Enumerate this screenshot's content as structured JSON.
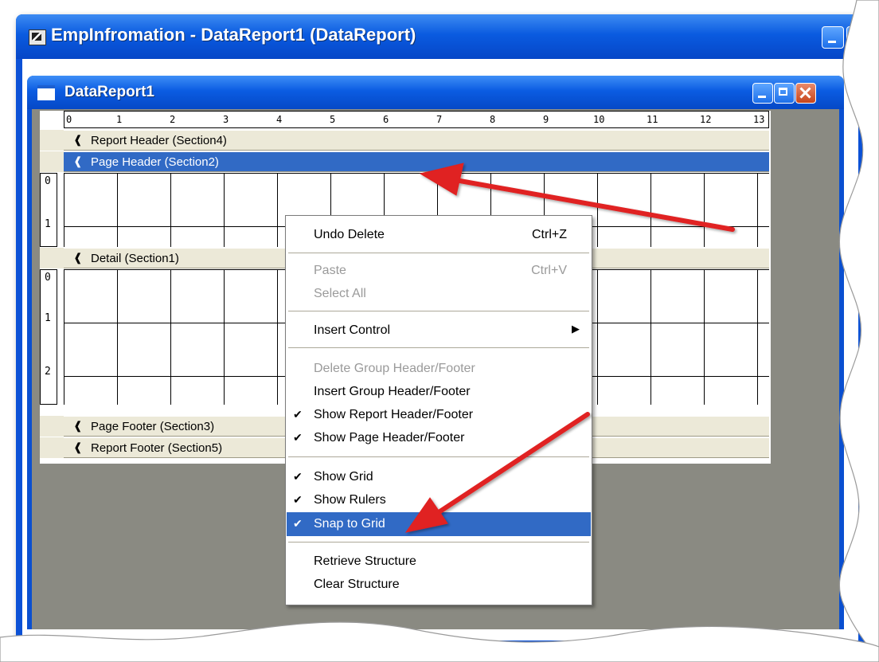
{
  "outer_window": {
    "title": "EmpInfromation - DataReport1 (DataReport)"
  },
  "inner_window": {
    "title": "DataReport1"
  },
  "ruler": {
    "horizontal_ticks": [
      "0",
      "1",
      "2",
      "3",
      "4",
      "5",
      "6",
      "7",
      "8",
      "9",
      "10",
      "11",
      "12",
      "13"
    ],
    "page_header_ticks": [
      "0",
      "1"
    ],
    "detail_ticks": [
      "0",
      "1",
      "2"
    ]
  },
  "sections": {
    "report_header": "Report Header (Section4)",
    "page_header": "Page Header (Section2)",
    "detail": "Detail (Section1)",
    "page_footer": "Page Footer (Section3)",
    "report_footer": "Report Footer (Section5)"
  },
  "context_menu": {
    "undo_delete": {
      "label": "Undo Delete",
      "shortcut": "Ctrl+Z"
    },
    "paste": {
      "label": "Paste",
      "shortcut": "Ctrl+V"
    },
    "select_all": {
      "label": "Select All"
    },
    "insert_control": {
      "label": "Insert Control"
    },
    "delete_group": {
      "label": "Delete Group Header/Footer"
    },
    "insert_group": {
      "label": "Insert Group Header/Footer"
    },
    "show_report_hf": {
      "label": "Show Report Header/Footer",
      "checked": true
    },
    "show_page_hf": {
      "label": "Show Page Header/Footer",
      "checked": true
    },
    "show_grid": {
      "label": "Show Grid",
      "checked": true
    },
    "show_rulers": {
      "label": "Show Rulers",
      "checked": true
    },
    "snap_to_grid": {
      "label": "Snap to Grid",
      "checked": true
    },
    "retrieve_structure": {
      "label": "Retrieve Structure"
    },
    "clear_structure": {
      "label": "Clear Structure"
    }
  },
  "colors": {
    "titlebar": "#0A5BE0",
    "selection": "#316AC5",
    "annotation_arrow": "#E02020"
  }
}
